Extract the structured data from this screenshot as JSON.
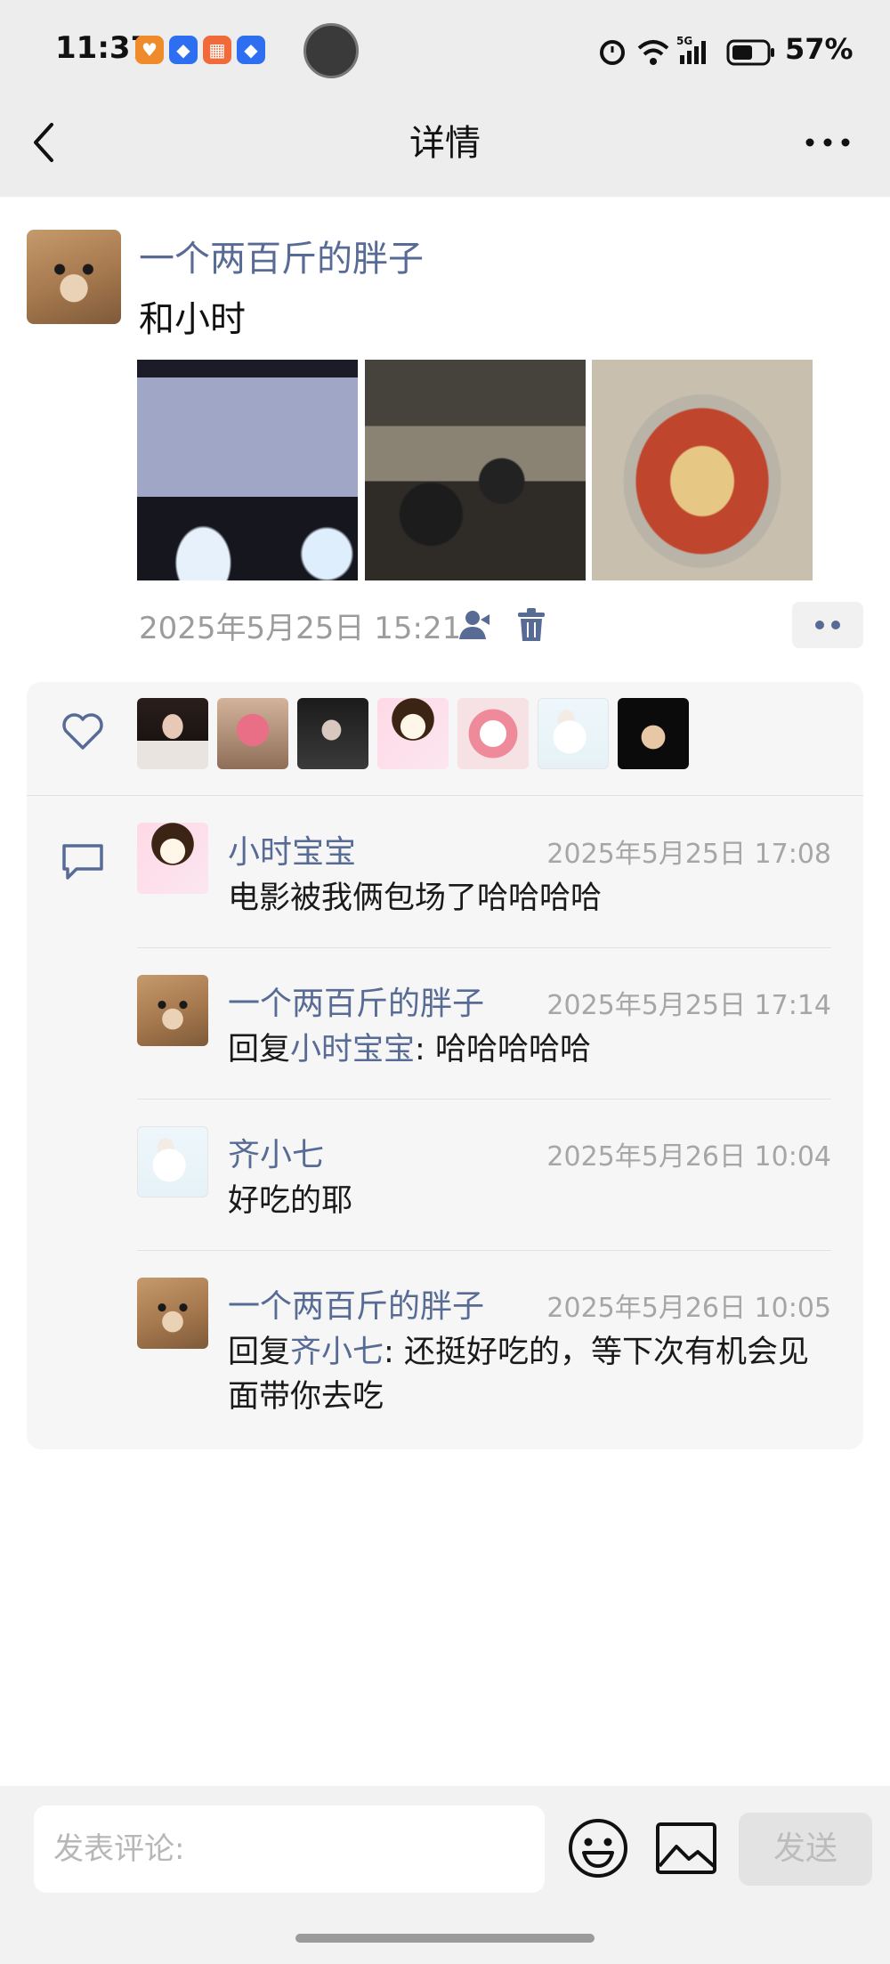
{
  "status_bar": {
    "time": "11:37",
    "battery": "57%",
    "network": "5G",
    "app_icons": [
      "heart-app-icon",
      "cube-app-icon",
      "grid-app-icon",
      "cube-app-icon"
    ]
  },
  "header": {
    "title": "详情"
  },
  "post": {
    "author": "一个两百斤的胖子",
    "text": "和小时",
    "time": "2025年5月25日 15:21",
    "photo_count": 3
  },
  "likes": {
    "count": 7,
    "avatars": [
      "like-avatar-1",
      "like-avatar-2",
      "like-avatar-3",
      "like-avatar-4",
      "like-avatar-5",
      "like-avatar-6",
      "like-avatar-7"
    ]
  },
  "comments": [
    {
      "name": "小时宝宝",
      "time": "2025年5月25日 17:08",
      "text": "电影被我俩包场了哈哈哈哈"
    },
    {
      "name": "一个两百斤的胖子",
      "time": "2025年5月25日 17:14",
      "reply_prefix": "回复",
      "reply_to": "小时宝宝",
      "text": ": 哈哈哈哈哈"
    },
    {
      "name": "齐小七",
      "time": "2025年5月26日 10:04",
      "text": "好吃的耶"
    },
    {
      "name": "一个两百斤的胖子",
      "time": "2025年5月26日 10:05",
      "reply_prefix": "回复",
      "reply_to": "齐小七",
      "text": ": 还挺好吃的，等下次有机会见面带你去吃"
    }
  ],
  "input": {
    "placeholder": "发表评论:",
    "send_label": "发送"
  }
}
